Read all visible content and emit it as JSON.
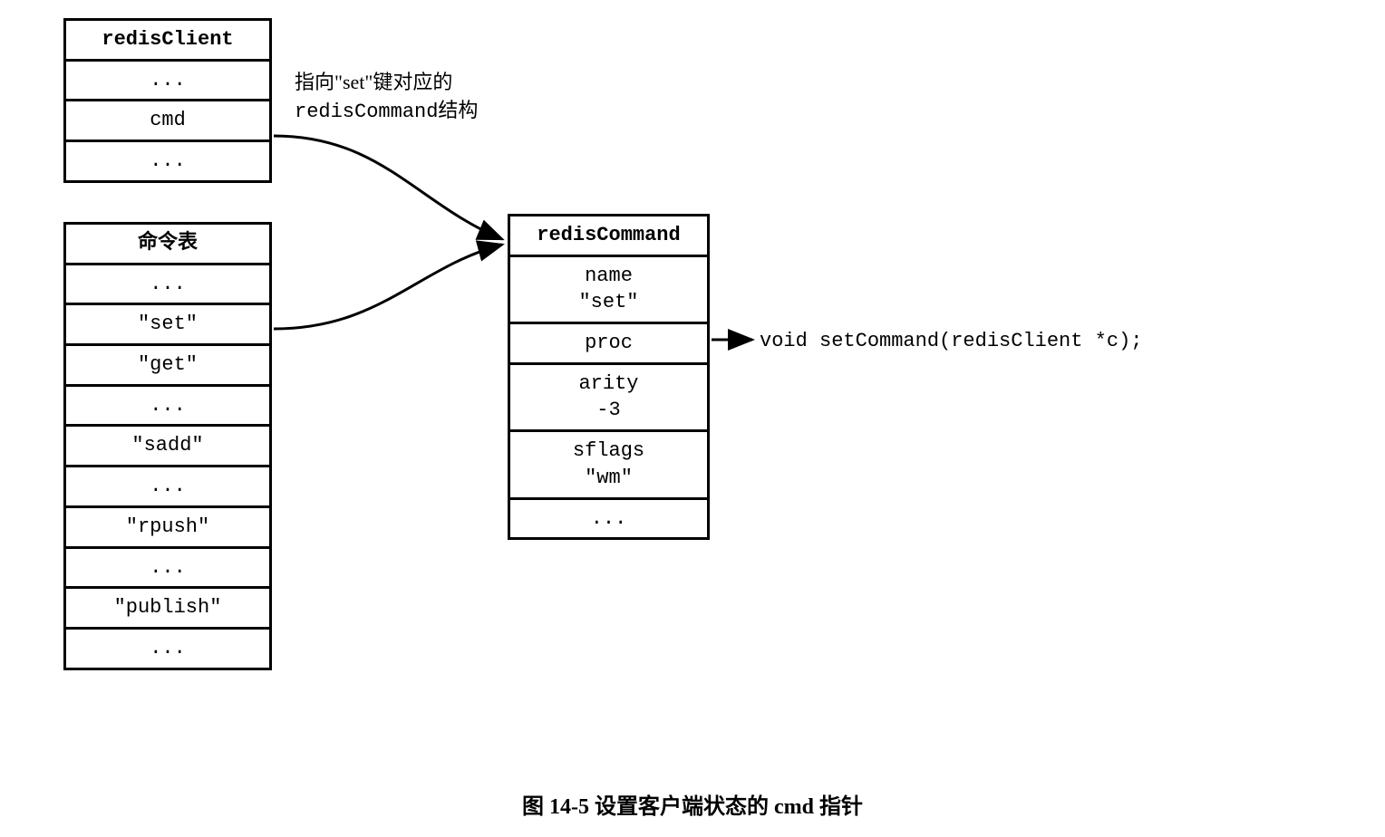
{
  "redisClient": {
    "title": "redisClient",
    "rows": [
      "...",
      "cmd",
      "..."
    ]
  },
  "commandTable": {
    "title": "命令表",
    "rows": [
      "...",
      "\"set\"",
      "\"get\"",
      "...",
      "\"sadd\"",
      "...",
      "\"rpush\"",
      "...",
      "\"publish\"",
      "..."
    ]
  },
  "redisCommand": {
    "title": "redisCommand",
    "rows": [
      "name\n\"set\"",
      "proc",
      "arity\n-3",
      "sflags\n\"wm\"",
      "..."
    ]
  },
  "annotation": {
    "line1": "指向\"set\"键对应的",
    "line2": "redisCommand结构"
  },
  "procTarget": "void setCommand(redisClient *c);",
  "caption": "图 14-5  设置客户端状态的 cmd 指针"
}
